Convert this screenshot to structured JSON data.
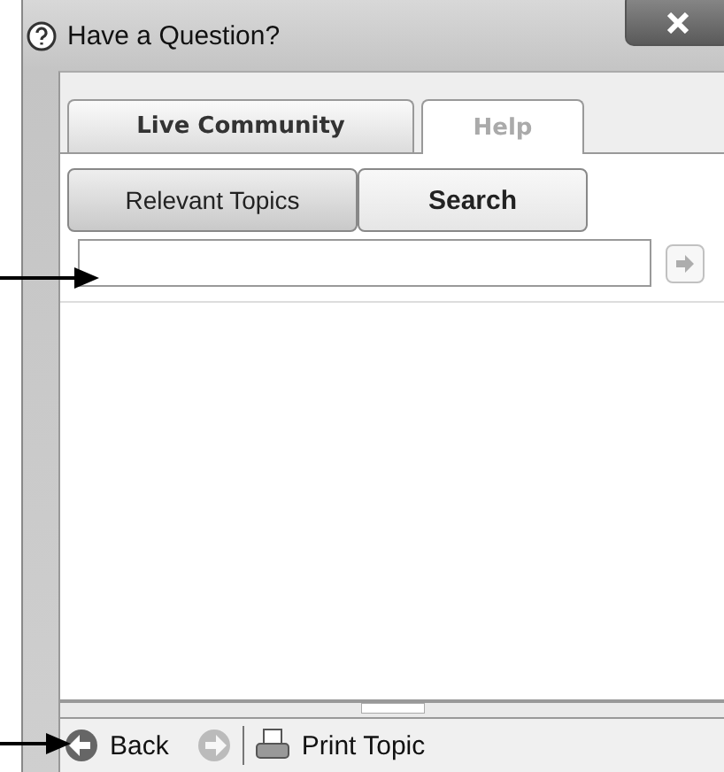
{
  "window": {
    "title": "Have a Question?"
  },
  "tabs": [
    {
      "label": "Live Community",
      "selected": false
    },
    {
      "label": "Help",
      "selected": true
    }
  ],
  "subtabs": [
    {
      "label": "Relevant Topics",
      "selected": false
    },
    {
      "label": "Search",
      "selected": true
    }
  ],
  "search": {
    "go_disabled": true
  },
  "toolbar": {
    "back": "Back",
    "forward_disabled": true,
    "print": "Print Topic"
  }
}
